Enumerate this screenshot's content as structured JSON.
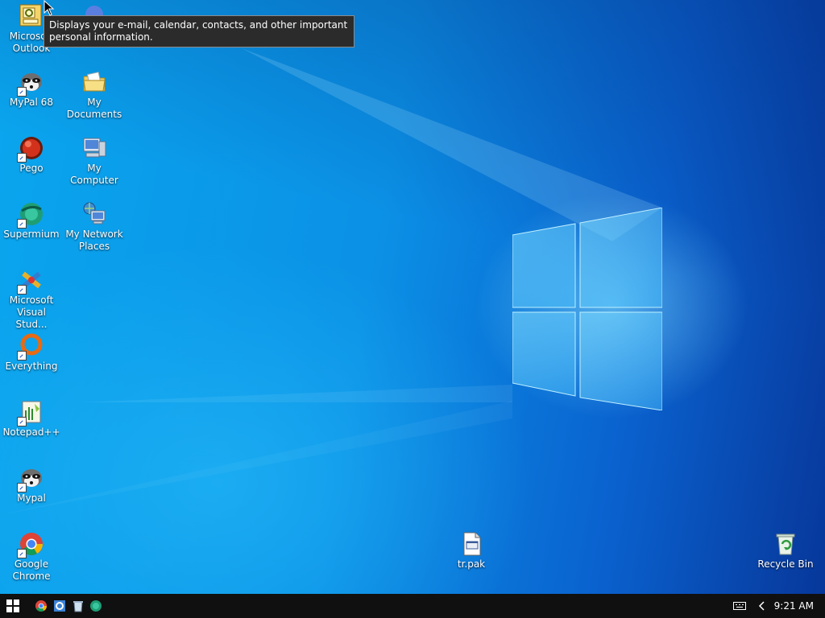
{
  "tooltip": {
    "text": "Displays your e-mail, calendar, contacts, and other important personal information."
  },
  "desktop": {
    "icons": {
      "outlook": "Microsoft Outlook",
      "mypal68": "MyPal 68",
      "my_documents": "My Documents",
      "pego": "Pego",
      "my_computer": "My Computer",
      "supermium": "Supermium",
      "my_network_places": "My Network Places",
      "visual_studio": "Microsoft Visual Stud...",
      "everything": "Everything",
      "notepadpp": "Notepad++",
      "mypal": "Mypal",
      "google_chrome": "Google Chrome",
      "trpak": "tr.pak",
      "recycle_bin": "Recycle Bin"
    }
  },
  "taskbar": {
    "pinned": [
      "chrome-icon",
      "ie-icon",
      "recycle-bin-small-icon",
      "supermium-small-icon"
    ],
    "clock": "9:21 AM"
  },
  "colors": {
    "taskbar": "#101010",
    "desktop_accent": "#0a8fe4"
  }
}
